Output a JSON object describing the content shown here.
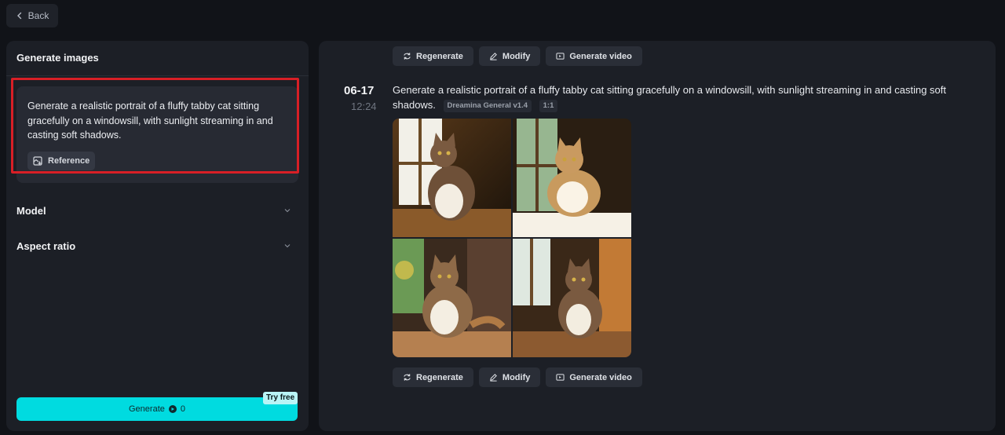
{
  "header": {
    "back_label": "Back",
    "back_icon": "chevron-left-icon"
  },
  "left_panel": {
    "title": "Generate images",
    "prompt_text": "Generate a realistic portrait of a fluffy tabby cat sitting gracefully on a windowsill, with sunlight streaming in and casting soft shadows.",
    "reference_label": "Reference",
    "reference_icon": "reference-image-icon",
    "model_label": "Model",
    "aspect_ratio_label": "Aspect ratio",
    "generate_label": "Generate",
    "generate_cost": "0",
    "try_free_label": "Try free",
    "accent_color": "#00dbe0",
    "highlight_color": "#d81f26"
  },
  "history": {
    "actions_top": [
      {
        "label": "Regenerate",
        "icon": "regenerate-icon"
      },
      {
        "label": "Modify",
        "icon": "pencil-icon"
      },
      {
        "label": "Generate video",
        "icon": "video-icon"
      }
    ],
    "actions_bottom": [
      {
        "label": "Regenerate",
        "icon": "regenerate-icon"
      },
      {
        "label": "Modify",
        "icon": "pencil-icon"
      },
      {
        "label": "Generate video",
        "icon": "video-icon"
      }
    ],
    "item": {
      "date": "06-17",
      "time": "12:24",
      "prompt": "Generate a realistic portrait of a fluffy tabby cat sitting gracefully on a windowsill, with sunlight streaming in and casting soft shadows.",
      "model_tag": "Dreamina General v1.4",
      "ratio_tag": "1:1",
      "image_count": 4
    }
  }
}
